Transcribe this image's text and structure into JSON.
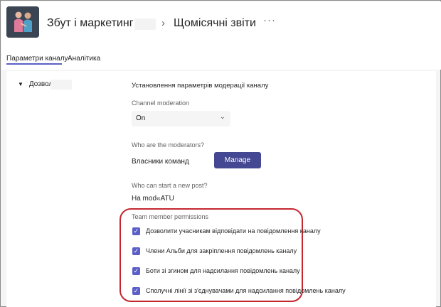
{
  "header": {
    "team_name": "Збут і маркетинг",
    "separator": "›",
    "channel_name": "Щомісячні звіти",
    "more": "···"
  },
  "tabs": [
    {
      "label": "Параметри каналу",
      "active": true
    },
    {
      "label": "Аналітика",
      "active": false
    }
  ],
  "section": {
    "arrow": "▼",
    "title": "Дозволи"
  },
  "moderation": {
    "heading": "Установлення параметрів модерації каналу",
    "channel_moderation_label": "Channel moderation",
    "channel_moderation_value": "On",
    "chevron": "⌄",
    "moderators_label": "Who are the moderators?",
    "moderators_value": "Власники команд",
    "manage_button": "Manage",
    "new_post_label": "Who can start a new post?",
    "new_post_value": "На mod«ATU"
  },
  "permissions": {
    "label": "Team member permissions",
    "items": [
      {
        "label": "Дозволити учасникам відповідати на повідомлення каналу",
        "checked": true
      },
      {
        "label": "Члени Альби для закріплення повідомлень каналу",
        "checked": true
      },
      {
        "label": "Боти зі згином для надсилання повідомлень каналу",
        "checked": true
      },
      {
        "label": "Сполучні лінії зі з'єднувачами для надсилання повідомлень каналу",
        "checked": true
      }
    ],
    "check_glyph": "✓"
  },
  "colors": {
    "accent": "#5b5fc7",
    "button": "#444791",
    "highlight": "#c4262e"
  }
}
